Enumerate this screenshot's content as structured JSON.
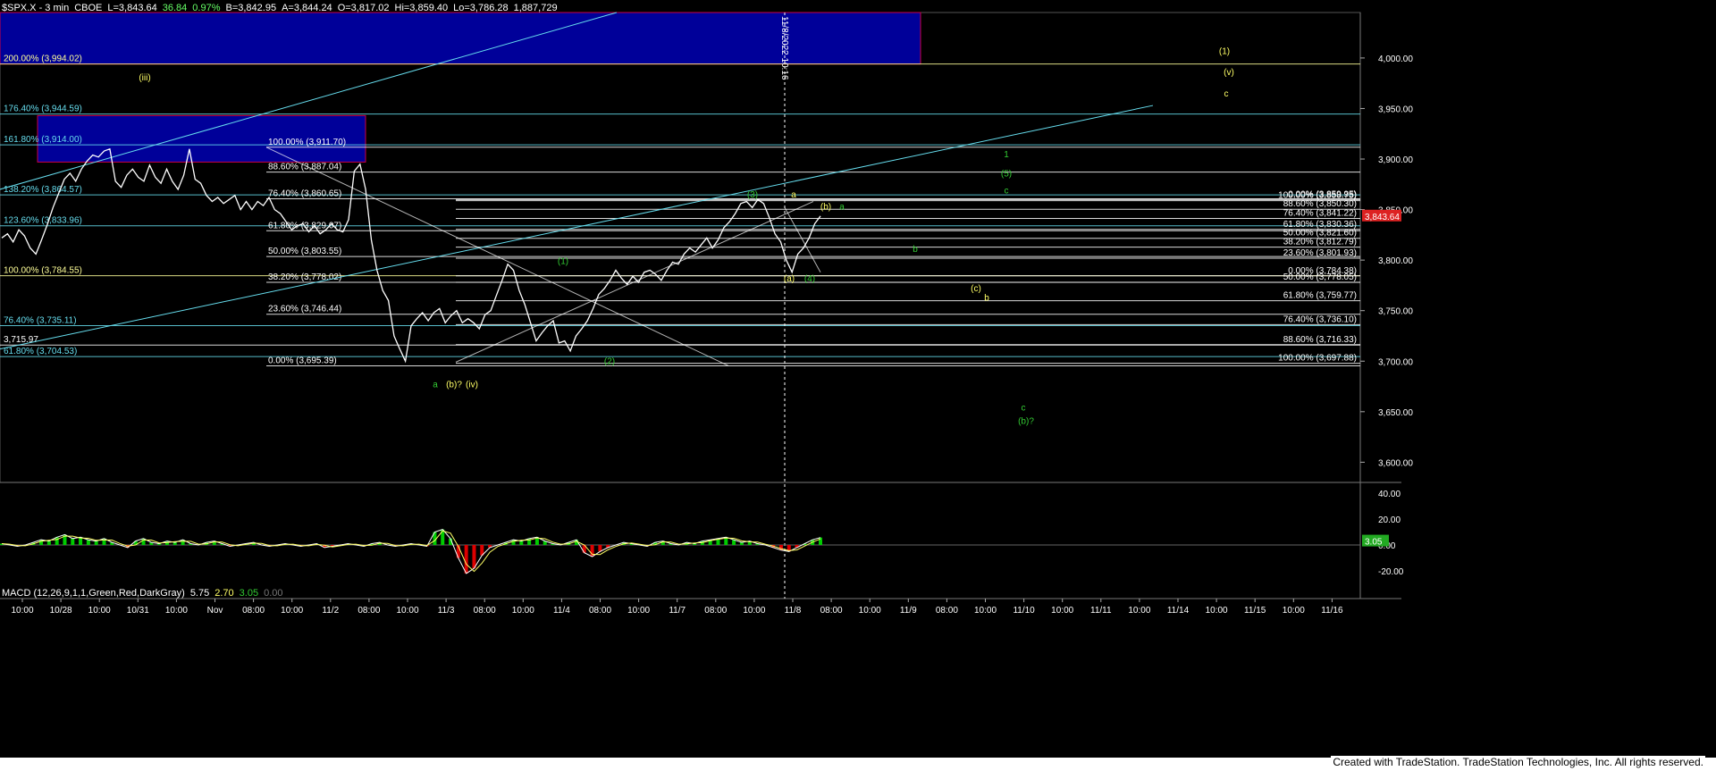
{
  "window": {
    "title": "$SPX.X - 3 min CBOE"
  },
  "header": {
    "symbol": "$SPX.X - 3 min",
    "exchange": "CBOE",
    "last": "L=3,843.64",
    "change": "36.84",
    "change_pct": "0.97%",
    "bid": "B=3,842.95",
    "ask": "A=3,844.24",
    "open": "O=3,817.02",
    "high": "Hi=3,859.40",
    "low": "Lo=3,786.28",
    "volume": "1,887,729"
  },
  "macd": {
    "label": "MACD (12,26,9,1,1,Green,Red,DarkGray)",
    "v1": "5.75",
    "v2": "2.70",
    "v3": "3.05",
    "v4": "0.00",
    "current_tag": "3.05",
    "y_ticks": [
      "40.00",
      "20.00",
      "0.00",
      "-20.00"
    ]
  },
  "credit": "Created with TradeStation. TradeStation Technologies, Inc. All rights reserved.",
  "colors": {
    "price": "#ffffff",
    "fib_yellow": "#ffff99",
    "fib_cyan": "#66ddee",
    "wave_green": "#33cc33",
    "wave_yellow": "#ffff66",
    "macd_hist_pos": "#00cc00",
    "macd_hist_neg": "#dd0000",
    "box_fill": "#000099",
    "box_border": "#cc0044"
  },
  "chart_data": {
    "type": "line",
    "price_axis": {
      "ylim": [
        3580,
        4045
      ],
      "ticks": [
        "4,000.00",
        "3,950.00",
        "3,900.00",
        "3,850.00",
        "3,800.00",
        "3,750.00",
        "3,700.00",
        "3,650.00",
        "3,600.00"
      ],
      "tick_values": [
        4000,
        3950,
        3900,
        3850,
        3800,
        3750,
        3700,
        3650,
        3600
      ]
    },
    "current_price_tag": "3,843.64",
    "time_axis_labels": [
      "10:00",
      "10/28",
      "10:00",
      "10/31",
      "10:00",
      "Nov",
      "08:00",
      "10:00",
      "11/2",
      "08:00",
      "10:00",
      "11/3",
      "08:00",
      "10:00",
      "11/4",
      "08:00",
      "10:00",
      "11/7",
      "08:00",
      "10:00",
      "11/8",
      "08:00",
      "10:00",
      "11/9",
      "08:00",
      "10:00",
      "11/10",
      "10:00",
      "11/11",
      "10:00",
      "11/14",
      "10:00",
      "11/15",
      "10:00",
      "11/16"
    ],
    "vertical_marker": {
      "label": "11/8/2022 10:16"
    },
    "series": [
      {
        "name": "",
        "values": [
          3822,
          3826,
          3818,
          3830,
          3824,
          3812,
          3806,
          3820,
          3835,
          3852,
          3866,
          3880,
          3886,
          3878,
          3890,
          3898,
          3904,
          3902,
          3908,
          3910,
          3878,
          3872,
          3884,
          3890,
          3882,
          3878,
          3894,
          3882,
          3876,
          3890,
          3878,
          3870,
          3884,
          3910,
          3880,
          3876,
          3864,
          3858,
          3862,
          3856,
          3860,
          3864,
          3850,
          3858,
          3850,
          3858,
          3854,
          3862,
          3850,
          3846,
          3838,
          3830,
          3834,
          3836,
          3828,
          3834,
          3826,
          3830,
          3836,
          3830,
          3828,
          3840,
          3888,
          3895,
          3870,
          3820,
          3790,
          3770,
          3760,
          3725,
          3712,
          3700,
          3735,
          3742,
          3748,
          3740,
          3748,
          3752,
          3738,
          3745,
          3750,
          3738,
          3742,
          3738,
          3732,
          3746,
          3750,
          3765,
          3780,
          3796,
          3790,
          3770,
          3756,
          3738,
          3720,
          3728,
          3735,
          3740,
          3718,
          3720,
          3710,
          3725,
          3732,
          3740,
          3752,
          3766,
          3772,
          3780,
          3790,
          3782,
          3776,
          3784,
          3778,
          3788,
          3790,
          3786,
          3780,
          3790,
          3798,
          3796,
          3806,
          3812,
          3808,
          3815,
          3822,
          3812,
          3820,
          3832,
          3838,
          3846,
          3856,
          3858,
          3852,
          3860,
          3856,
          3842,
          3826,
          3818,
          3800,
          3788,
          3806,
          3812,
          3822,
          3836,
          3843.64
        ]
      },
      {
        "name": "MACD",
        "values": [
          1,
          0,
          -1,
          0,
          2,
          4,
          3,
          6,
          8,
          5,
          6,
          4,
          3,
          5,
          2,
          0,
          -2,
          3,
          5,
          2,
          1,
          3,
          2,
          4,
          1,
          0,
          2,
          3,
          1,
          -1,
          0,
          1,
          2,
          0,
          -1,
          0,
          1,
          0,
          -1,
          0,
          1,
          -2,
          -1,
          0,
          1,
          0,
          -1,
          1,
          2,
          0,
          -1,
          0,
          1,
          0,
          -1,
          10,
          12,
          5,
          -10,
          -22,
          -18,
          -8,
          -2,
          0,
          2,
          4,
          3,
          5,
          6,
          3,
          1,
          0,
          2,
          4,
          -6,
          -9,
          -5,
          -2,
          0,
          2,
          1,
          0,
          -1,
          2,
          3,
          1,
          0,
          2,
          1,
          3,
          4,
          5,
          6,
          4,
          2,
          3,
          1,
          0,
          -2,
          -4,
          -5,
          -2,
          1,
          4,
          5.75
        ]
      }
    ],
    "fib_levels": [
      {
        "label": "200.00% (3,994.02)",
        "value": 3994.02
      },
      {
        "label": "176.40% (3,944.59)",
        "value": 3944.59
      },
      {
        "label": "161.80% (3,914.00)",
        "value": 3914.0
      },
      {
        "label": "138.20% (3,864.57)",
        "value": 3864.57
      },
      {
        "label": "123.60% (3,833.96)",
        "value": 3833.96
      },
      {
        "label": "100.00% (3,784.55)",
        "value": 3784.55
      },
      {
        "label": "76.40% (3,735.11)",
        "value": 3735.11
      },
      {
        "label": "3,715.97",
        "value": 3715.97
      },
      {
        "label": "61.80% (3,704.53)",
        "value": 3704.53
      },
      {
        "label": "100.00% (3,911.70)",
        "value": 3911.7
      },
      {
        "label": "88.60% (3,887.04)",
        "value": 3887.04
      },
      {
        "label": "76.40% (3,860.65)",
        "value": 3860.65
      },
      {
        "label": "61.80% (3,829.07)",
        "value": 3829.07
      },
      {
        "label": "50.00% (3,803.55)",
        "value": 3803.55
      },
      {
        "label": "38.20% (3,778.02)",
        "value": 3778.02
      },
      {
        "label": "23.60% (3,746.44)",
        "value": 3746.44
      },
      {
        "label": "0.00% (3,695.39)",
        "value": 3695.39
      },
      {
        "label": "0.00% (3,859.95)",
        "value": 3859.95
      },
      {
        "label": "100.00% (3,858.75)",
        "value": 3858.75
      },
      {
        "label": "88.60% (3,850.30)",
        "value": 3850.3
      },
      {
        "label": "76.40% (3,841.22)",
        "value": 3841.22
      },
      {
        "label": "61.80% (3,830.36)",
        "value": 3830.36
      },
      {
        "label": "50.00% (3,821.60)",
        "value": 3821.6
      },
      {
        "label": "38.20% (3,812.79)",
        "value": 3812.79
      },
      {
        "label": "23.60% (3,801.93)",
        "value": 3801.93
      },
      {
        "label": "0.00% (3,784.38)",
        "value": 3784.38
      },
      {
        "label": "50.00% (3,778.05)",
        "value": 3778.05
      },
      {
        "label": "61.80% (3,759.77)",
        "value": 3759.77
      },
      {
        "label": "76.40% (3,736.10)",
        "value": 3736.1
      },
      {
        "label": "88.60% (3,716.33)",
        "value": 3716.33
      },
      {
        "label": "100.00% (3,697.88)",
        "value": 3697.88
      }
    ],
    "wave_labels": [
      "(iii)",
      "(1)",
      "(v)",
      "c",
      "(3)",
      "a",
      "(b)",
      "a",
      "1",
      "(5)",
      "c",
      "b",
      "(a)",
      "(4)",
      "(c)",
      "b",
      "(1)",
      "(2)",
      "a",
      "(b)?",
      "(iv)",
      "c",
      "(b)?"
    ]
  }
}
